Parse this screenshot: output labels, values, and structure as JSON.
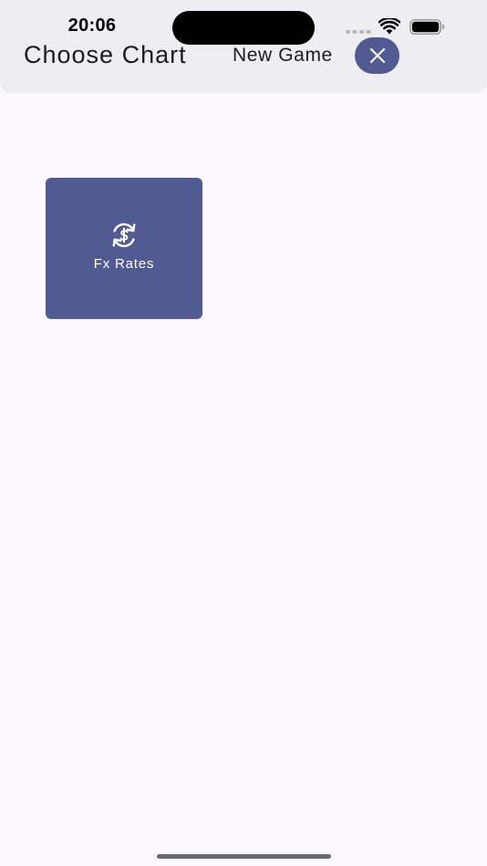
{
  "status_bar": {
    "time": "20:06",
    "icons": [
      "cellular-signal-icon",
      "wifi-icon",
      "battery-icon"
    ]
  },
  "header": {
    "title": "Choose Chart",
    "new_game_label": "New Game",
    "close_icon": "close-icon"
  },
  "charts": [
    {
      "label": "Fx Rates",
      "icon": "currency-exchange-icon"
    }
  ],
  "colors": {
    "accent": "#525A92",
    "background": "#FAF7FE",
    "header_background": "#EEEDF2",
    "text": "#1C1B22"
  }
}
